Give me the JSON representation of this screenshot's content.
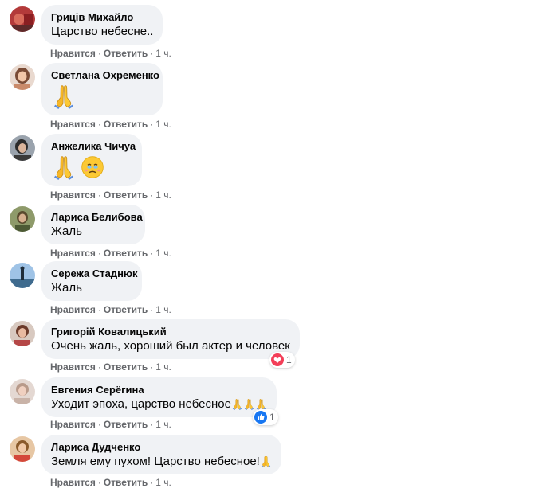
{
  "actions": {
    "like": "Нравится",
    "reply": "Ответить",
    "sep": "·"
  },
  "comments": [
    {
      "author": "Гриців Михайло",
      "text": "Царство небесне..",
      "time": "1 ч."
    },
    {
      "author": "Светлана Охременко",
      "emoji": [
        "folded-hands"
      ],
      "time": "1 ч."
    },
    {
      "author": "Анжелика Чичуа",
      "emoji": [
        "folded-hands",
        "face-holding-back-tears"
      ],
      "time": "1 ч."
    },
    {
      "author": "Лариса Белибова",
      "text": "Жаль",
      "time": "1 ч."
    },
    {
      "author": "Сережа Стаднюк",
      "text": "Жаль",
      "time": "1 ч."
    },
    {
      "author": "Григорій Ковалицький",
      "text": "Очень жаль, хороший был актер и человек",
      "time": "1 ч.",
      "reaction": {
        "type": "love",
        "count": "1",
        "color": "#f33e58"
      }
    },
    {
      "author": "Евгения Серёгина",
      "text": "Уходит эпоха, царство небесное",
      "trailing_emoji": [
        "folded-hands",
        "folded-hands",
        "folded-hands"
      ],
      "time": "1 ч.",
      "reaction": {
        "type": "like",
        "count": "1",
        "color": "#1877f2"
      }
    },
    {
      "author": "Лариса Дудченко",
      "text": "Земля ему пухом! Царство небесное!",
      "trailing_emoji": [
        "folded-hands"
      ],
      "time": "1 ч."
    }
  ]
}
